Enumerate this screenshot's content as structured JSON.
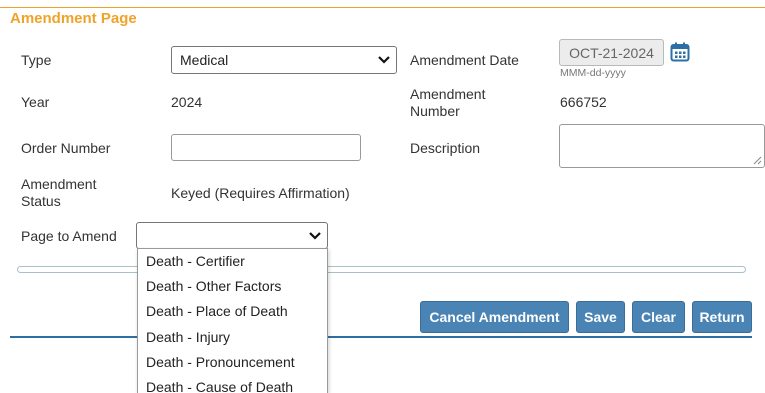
{
  "page": {
    "title": "Amendment Page"
  },
  "form": {
    "type_label": "Type",
    "type_value": "Medical",
    "year_label": "Year",
    "year_value": "2024",
    "order_label": "Order Number",
    "order_value": "",
    "status_label": "Amendment Status",
    "status_value": "Keyed (Requires Affirmation)",
    "page_label": "Page to Amend",
    "page_value": "",
    "amend_date_label": "Amendment Date",
    "amend_date_value": "OCT-21-2024",
    "date_format_hint": "MMM-dd-yyyy",
    "amend_number_label": "Amendment Number",
    "amend_number_value": "666752",
    "description_label": "Description",
    "description_value": ""
  },
  "dropdown": {
    "options": [
      "Death - Certifier",
      "Death - Other Factors",
      "Death - Place of Death",
      "Death - Injury",
      "Death - Pronouncement",
      "Death - Cause of Death"
    ]
  },
  "buttons": {
    "cancel": "Cancel Amendment",
    "save": "Save",
    "clear": "Clear",
    "return": "Return"
  },
  "progress": {
    "value": 0
  },
  "colors": {
    "accent": "#f0a32a",
    "button": "#4a84b5",
    "divider": "#2d6fa5"
  },
  "icons": {
    "calendar": "calendar-icon",
    "chevron": "chevron-down-icon",
    "resize": "resize-grip-icon"
  }
}
